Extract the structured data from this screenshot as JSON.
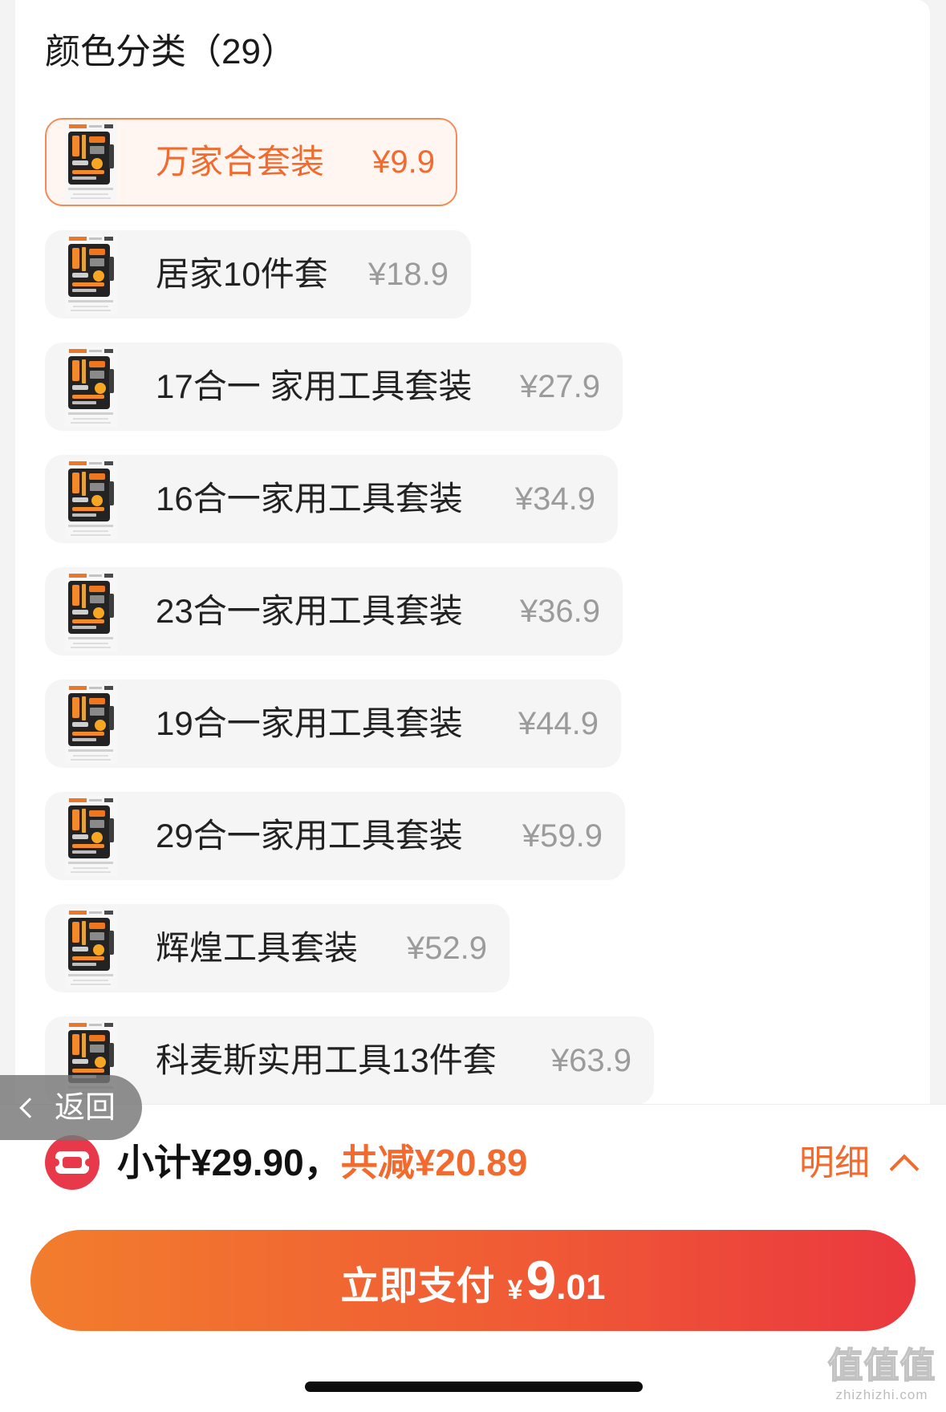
{
  "header": {
    "title": "颜色分类（29）"
  },
  "options": [
    {
      "name": "万家合套装",
      "price": "¥9.9",
      "selected": true
    },
    {
      "name": "居家10件套",
      "price": "¥18.9",
      "selected": false
    },
    {
      "name": "17合一 家用工具套装",
      "price": "¥27.9",
      "selected": false
    },
    {
      "name": "16合一家用工具套装",
      "price": "¥34.9",
      "selected": false
    },
    {
      "name": "23合一家用工具套装",
      "price": "¥36.9",
      "selected": false
    },
    {
      "name": "19合一家用工具套装",
      "price": "¥44.9",
      "selected": false
    },
    {
      "name": "29合一家用工具套装",
      "price": "¥59.9",
      "selected": false
    },
    {
      "name": "辉煌工具套装",
      "price": "¥52.9",
      "selected": false
    },
    {
      "name": "科麦斯实用工具13件套",
      "price": "¥63.9",
      "selected": false
    }
  ],
  "back": {
    "label": "返回",
    "icon": "chevron-left-icon"
  },
  "summary": {
    "coupon_icon": "coupon-icon",
    "subtotal": "小计¥29.90，",
    "discount": "共减¥20.89",
    "detail_label": "明细",
    "detail_icon": "chevron-up-icon"
  },
  "pay_button": {
    "label": "立即支付",
    "currency": "¥",
    "amount_int": "9",
    "amount_dec": ".01"
  },
  "watermark": {
    "logo": "值值值",
    "site": "zhizhizhi.com"
  },
  "colors": {
    "accent": "#f26a2e",
    "chip_bg": "#f5f5f5",
    "selected_bg": "#fff6f1",
    "selected_border": "#f38b56",
    "pay_start": "#f27d2d",
    "pay_end": "#ea383f",
    "price_grey": "#9b9b9b",
    "coupon_red": "#e8394a"
  }
}
